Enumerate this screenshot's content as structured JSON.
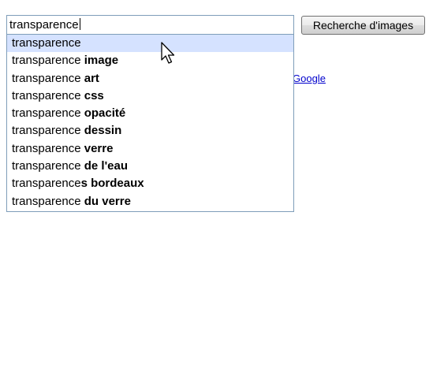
{
  "search": {
    "value": "transparence",
    "button_label": "Recherche d'images"
  },
  "link": {
    "label": "Google"
  },
  "suggestions": [
    {
      "prefix": "transparence",
      "suffix": "",
      "selected": true
    },
    {
      "prefix": "transparence ",
      "suffix": "image",
      "selected": false
    },
    {
      "prefix": "transparence ",
      "suffix": "art",
      "selected": false
    },
    {
      "prefix": "transparence ",
      "suffix": "css",
      "selected": false
    },
    {
      "prefix": "transparence ",
      "suffix": "opacité",
      "selected": false
    },
    {
      "prefix": "transparence ",
      "suffix": "dessin",
      "selected": false
    },
    {
      "prefix": "transparence ",
      "suffix": "verre",
      "selected": false
    },
    {
      "prefix": "transparence ",
      "suffix": "de l'eau",
      "selected": false
    },
    {
      "prefix": "transparence",
      "suffix": "s bordeaux",
      "selected": false
    },
    {
      "prefix": "transparence ",
      "suffix": "du verre",
      "selected": false
    }
  ],
  "colors": {
    "selected_row": "#d5e2ff",
    "link": "#0000cc",
    "input_border": "#7f9db9"
  },
  "icons": {
    "cursor": "mouse-pointer-icon"
  }
}
